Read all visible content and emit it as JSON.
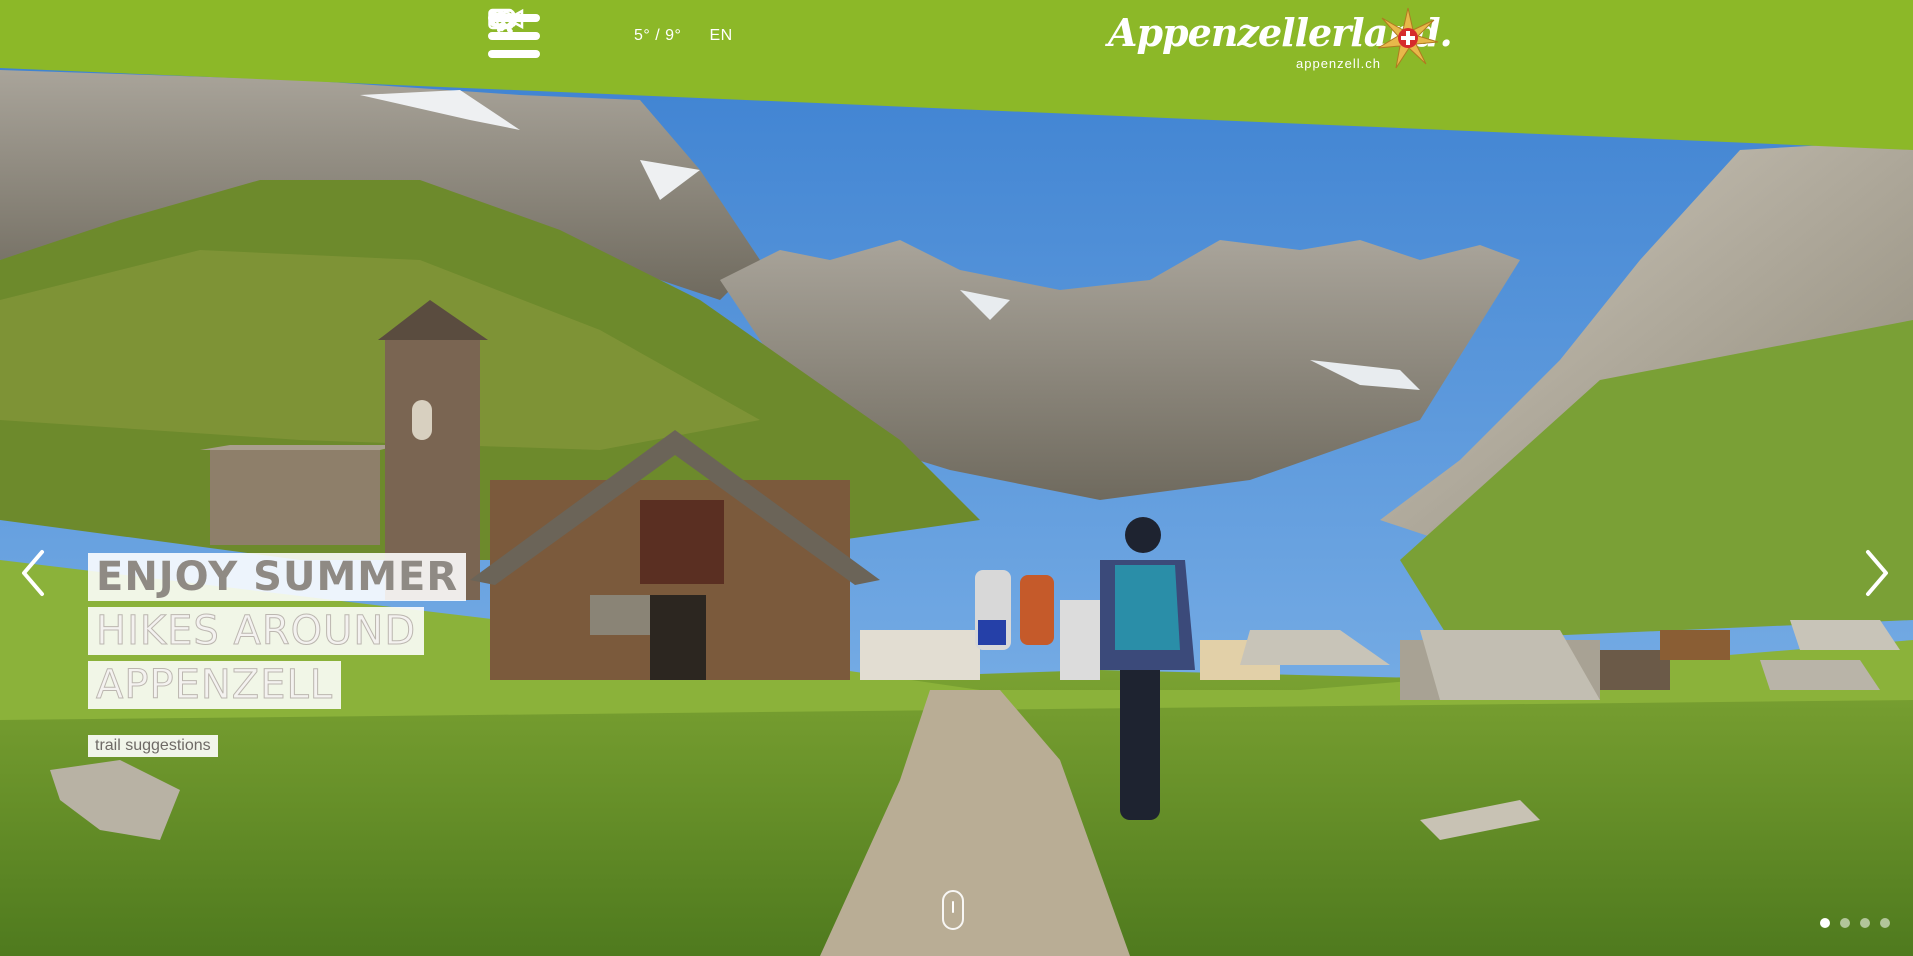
{
  "header": {
    "menu_icon": "hamburger-icon",
    "favorites_icon": "heart-icon",
    "weather": {
      "icon": "cloud-icon",
      "text": "5° / 9°"
    },
    "language": "EN",
    "video_icon": "video-camera-icon",
    "search_icon": "search-icon",
    "cart_icon": "shopping-cart-icon",
    "background_color": "#8cb828"
  },
  "brand": {
    "name": "Appenzellerland.",
    "domain": "appenzell.ch",
    "emblem_icon": "edelweiss-star-icon"
  },
  "hero": {
    "lines": [
      "ENJOY SUMMER",
      "HIKES AROUND",
      "APPENZELL"
    ],
    "button_label": "trail suggestions",
    "prev_icon": "chevron-left-icon",
    "next_icon": "chevron-right-icon",
    "scroll_icon": "mouse-scroll-icon",
    "slides_total": 4,
    "slide_active": 1
  }
}
